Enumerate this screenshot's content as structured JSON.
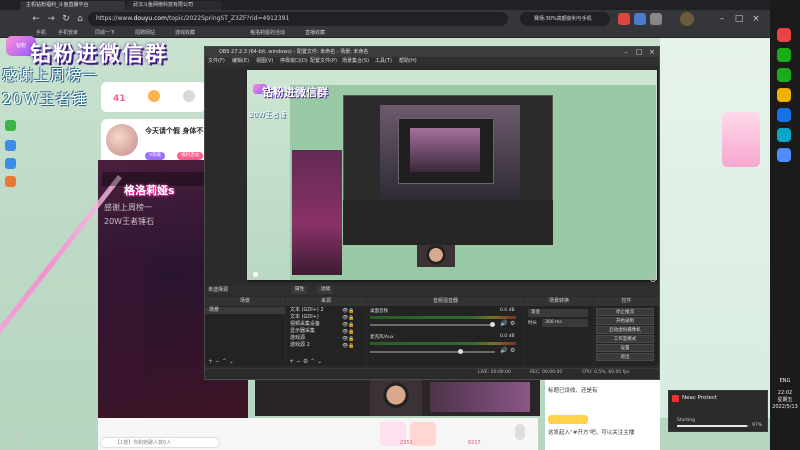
{
  "browser": {
    "tabs": [
      {
        "label": "主机钻粉福利_斗鱼直播平台"
      },
      {
        "label": "武汉斗鱼网络科技有限公司"
      }
    ],
    "url_prefix": "https://www.",
    "url_domain": "douyu.com",
    "url_path": "/topic/2022SpringST_Z3ZF?rid=4912391",
    "bookmarks": [
      "手机",
      "手机管家",
      "同城一下",
      "招聘网站",
      "游戏收藏",
      "格洛莉娅的活动",
      "直播收藏"
    ],
    "ad_text": "赛场:30%高额获利与手机"
  },
  "stream": {
    "overlay_title": "钻粉进微信群",
    "overlay_logo": "钻粉",
    "thanks_line1": "感谢上周榜一",
    "thanks_line2": "20W王者锤",
    "level_number": "41",
    "anchor_title": "今天请个假 身体不",
    "pill_v": "V等级",
    "pill_fans": "福利活动",
    "stream_name": "格洛莉娅s",
    "stream_sub1": "感谢上周榜一",
    "stream_sub2": "20W王者锤石",
    "comment_placeholder": "【1楼】你和她聊人数0人",
    "chat_line1": "标题已设收、还是有",
    "chat_line2": "这发起入“#开方’吧，可以关注主播",
    "bottom_number1": "2351",
    "bottom_number2": "6217"
  },
  "obs": {
    "title": "OBS 27.2.3 (64-bit, windows) - 配置文件: 未命名 - 场景: 未命名",
    "menu": [
      "文件(F)",
      "编辑(E)",
      "视图(V)",
      "停靠窗口(D)",
      "配置文件(P)",
      "场景集合(S)",
      "工具(T)",
      "帮助(H)"
    ],
    "no_source": "未选择源",
    "props_label": "属性",
    "filters_label": "滤镜",
    "docks": {
      "scenes": "场景",
      "sources": "来源",
      "mixer": "音频混音器",
      "transitions": "场景转换",
      "controls": "控件"
    },
    "scene_items": [
      "场景"
    ],
    "source_items": [
      "文本 (GDI+) 2",
      "文本 (GDI+)",
      "视频采集设备",
      "显示器采集",
      "游戏源",
      "游戏源 2"
    ],
    "mixer_channels": [
      {
        "name": "桌面音频",
        "db": "0.0 dB",
        "level": 0.6
      },
      {
        "name": "麦克风/Aux",
        "db": "0.0 dB",
        "level": 0.55
      }
    ],
    "transition": {
      "type": "渐变",
      "duration_label": "时长",
      "duration": "300 ms"
    },
    "controls": [
      "停止推流",
      "开始录制",
      "启动虚拟摄像机",
      "工作室模式",
      "设置",
      "退出"
    ],
    "status": {
      "live": "LIVE: 00:00:00",
      "rec": "REC: 00:00:00",
      "cpu": "CPU: 0.5%, 60.00 fps"
    }
  },
  "system": {
    "time": "22:02",
    "weekday": "星期五",
    "date": "2022/5/13",
    "lang": "ENG"
  },
  "neac": {
    "title": "Neac Protect",
    "status": "Starting",
    "percent_text": "97%",
    "progress": 0.97
  },
  "colors": {
    "obs_bg": "#2b2b2b",
    "page_green": "#c9e2d0",
    "accent_pink": "#ff5d8f"
  }
}
